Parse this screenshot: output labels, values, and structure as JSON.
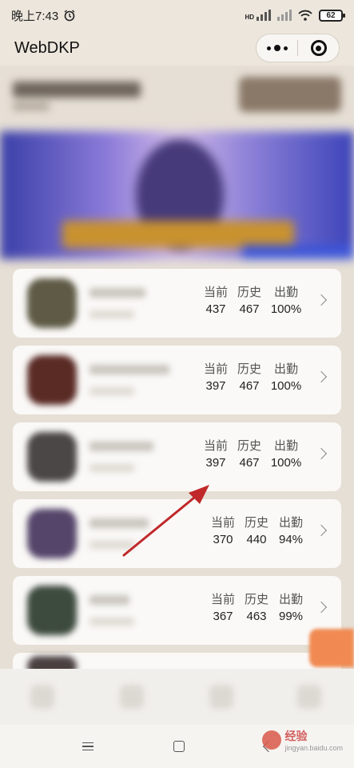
{
  "status_bar": {
    "time": "晚上7:43",
    "alarm_icon": "alarm-clock-icon",
    "network": "HD",
    "battery": "62"
  },
  "nav": {
    "title": "WebDKP",
    "more_icon": "more-dots-icon",
    "close_icon": "target-close-icon"
  },
  "rows": [
    {
      "labels": [
        "当前",
        "历史",
        "出勤"
      ],
      "values": [
        "437",
        "467",
        "100%"
      ],
      "avatar_color": "#5e5a45"
    },
    {
      "labels": [
        "当前",
        "历史",
        "出勤"
      ],
      "values": [
        "397",
        "467",
        "100%"
      ],
      "avatar_color": "#5a2a24"
    },
    {
      "labels": [
        "当前",
        "历史",
        "出勤"
      ],
      "values": [
        "397",
        "467",
        "100%"
      ],
      "avatar_color": "#4a4746"
    },
    {
      "labels": [
        "当前",
        "历史",
        "出勤"
      ],
      "values": [
        "370",
        "440",
        "94%"
      ],
      "avatar_color": "#55456a"
    },
    {
      "labels": [
        "当前",
        "历史",
        "出勤"
      ],
      "values": [
        "367",
        "463",
        "99%"
      ],
      "avatar_color": "#3d4a3e"
    }
  ],
  "watermark": {
    "brand": "Bai",
    "cn": "经验",
    "url": "jingyan.baidu.com"
  },
  "colors": {
    "accent_orange": "#f08a52",
    "arrow_red": "#c0282a"
  }
}
